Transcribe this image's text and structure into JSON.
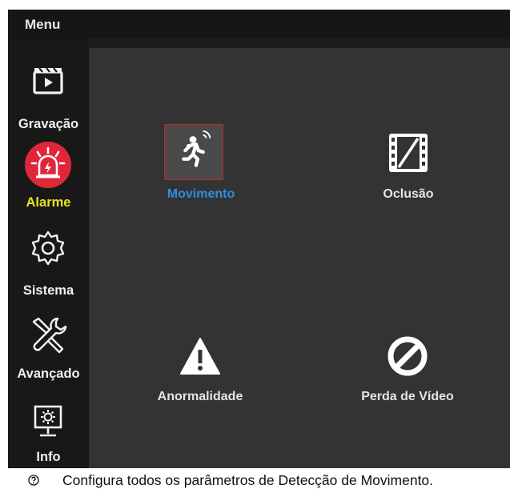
{
  "window": {
    "title": "Menu"
  },
  "sidebar": {
    "items": [
      {
        "label": "Gravação",
        "icon": "clapperboard-icon",
        "active": false
      },
      {
        "label": "Alarme",
        "icon": "alarm-siren-icon",
        "active": true
      },
      {
        "label": "Sistema",
        "icon": "gear-icon",
        "active": false
      },
      {
        "label": "Avançado",
        "icon": "wrench-screwdriver-icon",
        "active": false
      },
      {
        "label": "Info",
        "icon": "monitor-info-icon",
        "active": false
      }
    ]
  },
  "content": {
    "tiles": [
      {
        "label": "Movimento",
        "icon": "motion-person-icon",
        "selected": true
      },
      {
        "label": "Oclusão",
        "icon": "film-occlusion-icon",
        "selected": false
      },
      {
        "label": "Anormalidade",
        "icon": "warning-triangle-icon",
        "selected": false
      },
      {
        "label": "Perda de Vídeo",
        "icon": "no-signal-icon",
        "selected": false
      }
    ]
  },
  "footer": {
    "help_text": "Configura todos os parâmetros de Detecção de Movimento.",
    "icon": "question-circle-icon"
  },
  "colors": {
    "active_label": "#e8e619",
    "selected_tile_label": "#2e8fe0",
    "alarm_badge": "#e0273a",
    "selected_border": "#c0282c"
  }
}
